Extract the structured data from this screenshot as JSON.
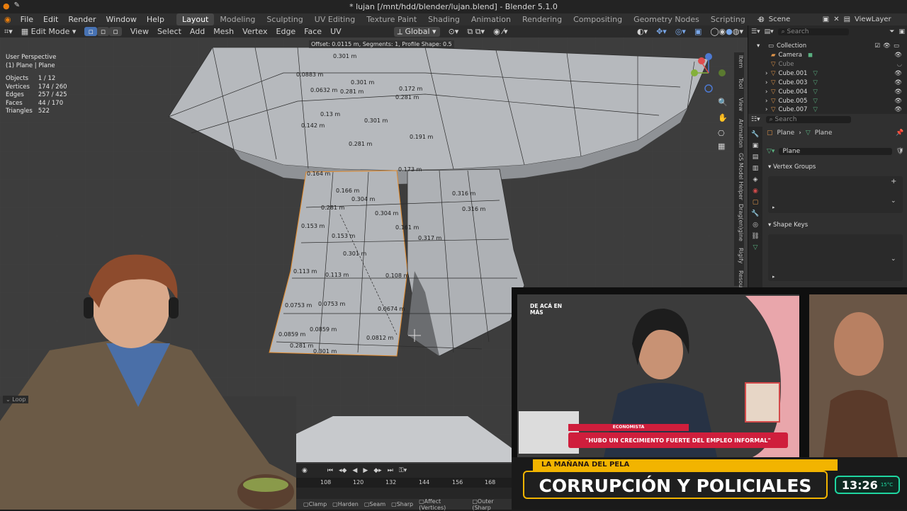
{
  "window": {
    "title": "* lujan [/mnt/hdd/blender/lujan.blend] - Blender 5.1.0"
  },
  "menu": [
    "File",
    "Edit",
    "Render",
    "Window",
    "Help"
  ],
  "workspaces": [
    "Layout",
    "Modeling",
    "Sculpting",
    "UV Editing",
    "Texture Paint",
    "Shading",
    "Animation",
    "Rendering",
    "Compositing",
    "Geometry Nodes",
    "Scripting"
  ],
  "workspace_add": "+",
  "scene": {
    "label": "Scene",
    "viewlayer": "ViewLayer"
  },
  "viewport_header": {
    "mode": "Edit Mode",
    "items": [
      "View",
      "Select",
      "Add",
      "Mesh",
      "Vertex",
      "Edge",
      "Face",
      "UV"
    ],
    "orientation": "Global"
  },
  "operator_tip": "Offset: 0.0115 m, Segments: 1, Profile Shape: 0.5",
  "overlay": {
    "view_name": "User Perspective",
    "object_name": "(1) Plane | Plane",
    "stats": [
      {
        "label": "Objects",
        "value": "1 / 12"
      },
      {
        "label": "Vertices",
        "value": "174 / 260"
      },
      {
        "label": "Edges",
        "value": "257 / 425"
      },
      {
        "label": "Faces",
        "value": "44 / 170"
      },
      {
        "label": "Triangles",
        "value": "522"
      }
    ]
  },
  "measurements": [
    "0.301 m",
    "0.0883 m",
    "0.0632 m",
    "0.301 m",
    "0.13 m",
    "0.142 m",
    "0.281 m",
    "0.172 m",
    "0.281 m",
    "0.281 m",
    "0.301 m",
    "0.164 m",
    "0.166 m",
    "0.304 m",
    "0.304 m",
    "0.281 m",
    "0.153 m",
    "0.153 m",
    "0.301 m",
    "0.113 m",
    "0.113 m",
    "0.108 m",
    "0.0753 m",
    "0.0753 m",
    "0.0674 m",
    "0.0859 m",
    "0.0859 m",
    "0.0812 m",
    "0.281 m",
    "0.301 m",
    "0.316 m",
    "0.316 m",
    "0.317 m",
    "0.191 m",
    "0.173 m",
    "0.161 m"
  ],
  "n_panel_tabs": [
    "Item",
    "Tool",
    "View",
    "Animation",
    "GS Model Helper",
    "Drag(en)gine",
    "Rigify",
    "Resou"
  ],
  "outliner": {
    "search_placeholder": "Search",
    "items": [
      {
        "name": "Collection",
        "type": "collection"
      },
      {
        "name": "Camera",
        "type": "camera"
      },
      {
        "name": "Cube",
        "type": "mesh"
      },
      {
        "name": "Cube.001",
        "type": "mesh"
      },
      {
        "name": "Cube.003",
        "type": "mesh"
      },
      {
        "name": "Cube.004",
        "type": "mesh"
      },
      {
        "name": "Cube.005",
        "type": "mesh"
      },
      {
        "name": "Cube.007",
        "type": "mesh"
      }
    ]
  },
  "properties": {
    "search_placeholder": "Search",
    "breadcrumb": [
      "Plane",
      "Plane"
    ],
    "data_name": "Plane",
    "panels": [
      "Vertex Groups",
      "Shape Keys"
    ]
  },
  "timeline": {
    "frames": [
      "108",
      "120",
      "132",
      "144",
      "156",
      "168"
    ]
  },
  "statusbar": [
    "Clamp",
    "Harden",
    "Seam",
    "Sharp",
    "Affect (Vertices)",
    "Outer (Sharp"
  ],
  "loop_label": "Loop",
  "stream": {
    "badge": "DE ACÁ EN MÁS",
    "lower_label": "ECONOMISTA",
    "quote": "\"HUBO UN CRECIMIENTO FUERTE DEL EMPLEO INFORMAL\"",
    "show_name": "LA MAÑANA DEL PELA",
    "headline": "CORRUPCIÓN Y POLICIALES",
    "clock": "13:26",
    "temp": "15°C"
  },
  "colors": {
    "accent": "#4772b3",
    "selection": "#ffa33d",
    "mesh_face": "#b3b6ba",
    "viewport_bg": "#3d3d3d",
    "clock_green": "#1fd6a0",
    "headline_bg": "#f2b400"
  }
}
